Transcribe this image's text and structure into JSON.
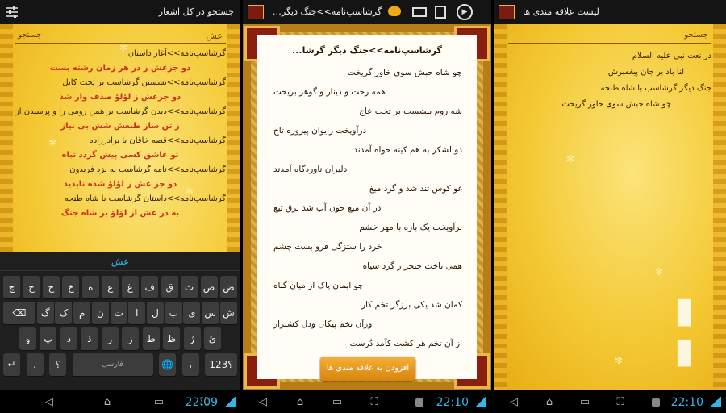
{
  "left": {
    "title": "جستجو در کل اشعار",
    "search": {
      "typed": "عش",
      "hint": "جستجو"
    },
    "rows": [
      {
        "text": "گرشاسپ‌نامه>>آغاز داستان",
        "style": "dark"
      },
      {
        "text": "دو جزعش ز در هر زمان رشته بست",
        "style": "red"
      },
      {
        "text": "گرشاسپ‌نامه>>نشستن گرشاسب بر تخت کابل",
        "style": "dark"
      },
      {
        "text": "دو جزعش ز لؤلؤ صدف وار شد",
        "style": "red"
      },
      {
        "text": "گرشاسپ‌نامه>>دیدن گرشاسب بر همن رومی را و پرسیدن ازو",
        "style": "dark"
      },
      {
        "text": "ز تن ساز طبعش شش بی نیاز",
        "style": "red"
      },
      {
        "text": "گرشاسپ‌نامه>>قصه خاقان با برادرزاده",
        "style": "dark"
      },
      {
        "text": "تو عاشق کسی پیش گردد تباه",
        "style": "red"
      },
      {
        "text": "گرشاسپ‌نامه>>نامه گرشاسب به نزد فریدون",
        "style": "dark"
      },
      {
        "text": "دو جز عش ز لؤلؤ شده ناپدید",
        "style": "red"
      },
      {
        "text": "گرشاسپ‌نامه>>داستان گرشاسب با شاه طنجه",
        "style": "dark"
      },
      {
        "text": "به در عش از لؤلؤ بر شاه جنگ",
        "style": "red"
      }
    ],
    "keyboard": {
      "suggestion": "عش",
      "row1": [
        "چ",
        "ج",
        "ح",
        "خ",
        "ه",
        "ع",
        "غ",
        "ف",
        "ق",
        "ث",
        "ص",
        "ض"
      ],
      "row2": [
        "⌫",
        "گ",
        "ک",
        "م",
        "ن",
        "ت",
        "ا",
        "ل",
        "ب",
        "ی",
        "س",
        "ش"
      ],
      "row3": [
        "و",
        "پ",
        "د",
        "ذ",
        "ر",
        "ز",
        "ط",
        "ظ",
        "ژ",
        "ئ"
      ],
      "row4": [
        "↵",
        ".",
        "؟",
        "فارسی",
        "🌐",
        "،",
        "؟123"
      ],
      "space_label": "فارسی"
    },
    "clock": "22:09"
  },
  "middle": {
    "title": "گرشاسپ‌نامه>>جنگ دیگر گرشا...",
    "header": "گرشاسپ‌نامه>>جنگ دیگر گرشا...",
    "verses": [
      "چو شاه حبش سوی خاور گریخت",
      "همه رخت و دینار و گوهر بریخت",
      "شه روم بنشست بر تخت عاج",
      "درآویخت زایوان پیروزه تاج",
      "دو لشکر به هم کینه خواه آمدند",
      "دلیران ناوردگاه آمدند",
      "غو کوس تند شد و گرد میغ",
      "در آن میغ خون آب شد برق تیغ",
      "برآویخت یک باره با مهر خشم",
      "خرد را ستزگی فرو بست چشم",
      "همی تاخت خنجر ز گرد سیاه",
      "چو ایمان پاک از میان گناه",
      "کمان شد یکی برزگر تخم کار",
      "وزآن تخم پیکان ودل کشتزار",
      "از آن تخم هر کشت کآمد دُرست"
    ],
    "favorite_button": "افزودن به علاقه مندی ها",
    "clock": "22:10"
  },
  "right": {
    "title": "لیست علاقه مندی ها",
    "search_hint": "جستجو",
    "items": [
      "در نعت نبی علیه السلام",
      "لنا باد بر جان پیغمبرش",
      "جنگ دیگر گرشاسب با شاه طنجه",
      "چو شاه حبش سوی خاور گریخت"
    ],
    "clock": "22:10"
  },
  "colors": {
    "accent": "#33b5e5",
    "gold": "#f4c833",
    "red_text": "#c8321e",
    "dark_text": "#3a2000"
  }
}
